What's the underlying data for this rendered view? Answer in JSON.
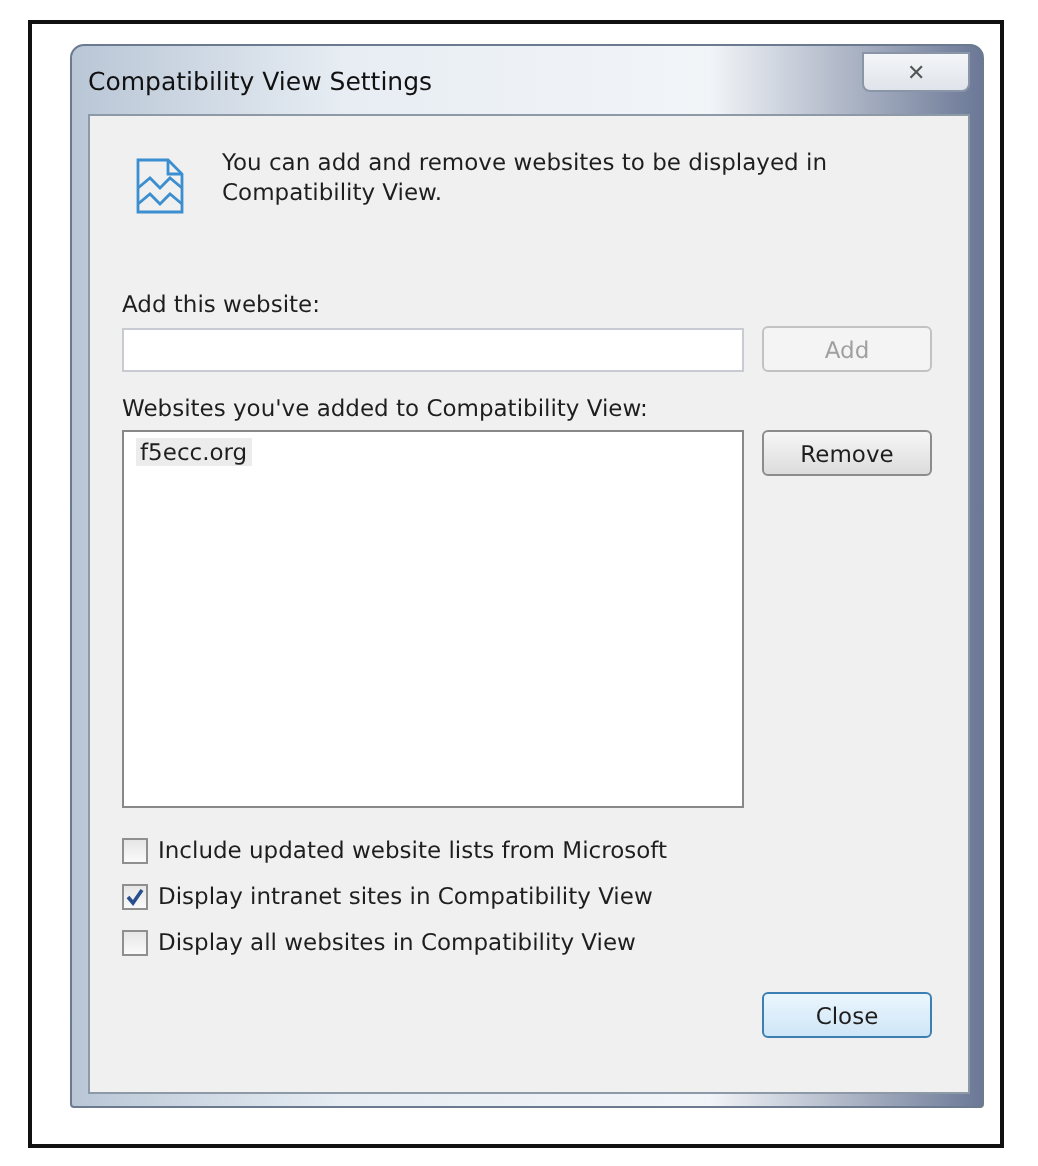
{
  "window": {
    "title": "Compatibility View Settings",
    "close_glyph": "✕"
  },
  "intro": "You can add and remove websites to be displayed in Compatibility View.",
  "add_field": {
    "label": "Add this website:",
    "button": {
      "label": "Add",
      "disabled": true
    }
  },
  "list": {
    "label": "Websites you've added to Compatibility View:",
    "items": [
      {
        "text": "f5ecc.org",
        "selected": true
      }
    ],
    "button": {
      "label": "Remove",
      "disabled": false
    }
  },
  "options": [
    {
      "label": "Include updated website lists from Microsoft",
      "checked": false
    },
    {
      "label": "Display intranet sites in Compatibility View",
      "checked": true
    },
    {
      "label": "Display all websites in Compatibility View",
      "checked": false
    }
  ],
  "buttons": [
    {
      "label": "Close",
      "kind": "default"
    }
  ]
}
